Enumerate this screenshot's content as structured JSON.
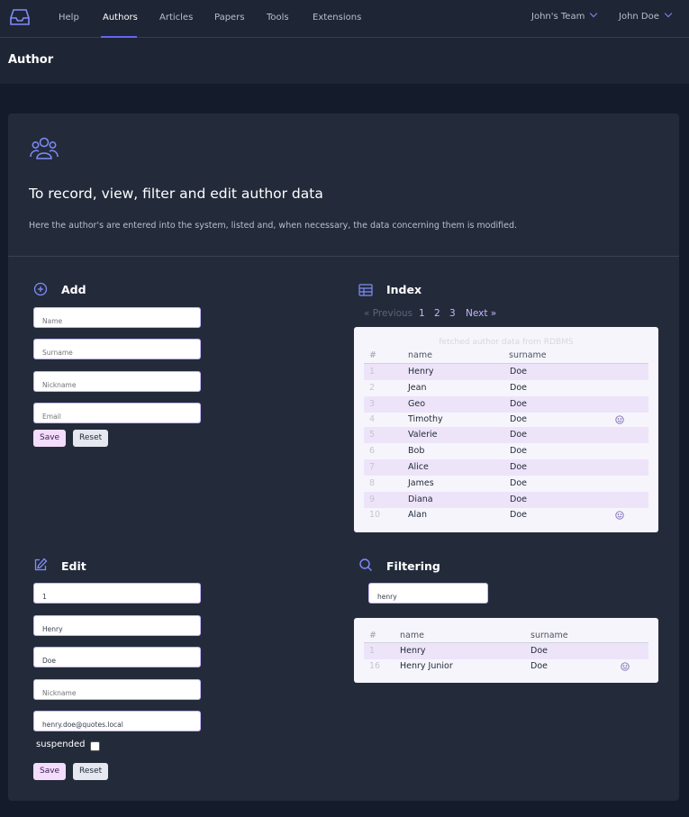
{
  "nav": {
    "logo": "inbox-logo-icon",
    "items": [
      {
        "label": "Help",
        "active": false
      },
      {
        "label": "Authors",
        "active": true
      },
      {
        "label": "Articles",
        "active": false
      },
      {
        "label": "Papers",
        "active": false
      },
      {
        "label": "Tools",
        "active": false
      },
      {
        "label": "Extensions",
        "active": false
      }
    ],
    "team_label": "John's Team",
    "user_label": "John Doe",
    "accent": "#6366f1"
  },
  "page": {
    "title": "Author"
  },
  "hero": {
    "icon": "user-group-icon",
    "title": "To record, view, filter and edit author data",
    "description": "Here the author's are entered into the system, listed and, when necessary, the data concerning them is modified."
  },
  "add": {
    "title": "Add",
    "icon": "plus-circle-icon",
    "name_placeholder": "Name",
    "surname_placeholder": "Surname",
    "nickname_placeholder": "Nickname",
    "email_placeholder": "Email",
    "save_label": "Save",
    "reset_label": "Reset"
  },
  "index": {
    "title": "Index",
    "icon": "table-icon",
    "pagination": {
      "previous": "« Previous",
      "pages": [
        "1",
        "2",
        "3"
      ],
      "next": "Next »"
    },
    "caption": "fetched author data from RDBMS",
    "columns": [
      "#",
      "name",
      "surname"
    ],
    "rows": [
      {
        "id": "1",
        "name": "Henry",
        "surname": "Doe",
        "smile": false
      },
      {
        "id": "2",
        "name": "Jean",
        "surname": "Doe",
        "smile": false
      },
      {
        "id": "3",
        "name": "Geo",
        "surname": "Doe",
        "smile": false
      },
      {
        "id": "4",
        "name": "Timothy",
        "surname": "Doe",
        "smile": true
      },
      {
        "id": "5",
        "name": "Valerie",
        "surname": "Doe",
        "smile": false
      },
      {
        "id": "6",
        "name": "Bob",
        "surname": "Doe",
        "smile": false
      },
      {
        "id": "7",
        "name": "Alice",
        "surname": "Doe",
        "smile": false
      },
      {
        "id": "8",
        "name": "James",
        "surname": "Doe",
        "smile": false
      },
      {
        "id": "9",
        "name": "Diana",
        "surname": "Doe",
        "smile": false
      },
      {
        "id": "10",
        "name": "Alan",
        "surname": "Doe",
        "smile": true
      }
    ]
  },
  "edit": {
    "title": "Edit",
    "icon": "pencil-square-icon",
    "id_value": "1",
    "name_value": "Henry",
    "surname_value": "Doe",
    "nickname_placeholder": "Nickname",
    "email_value": "henry.doe@quotes.local",
    "suspended_label": "suspended",
    "suspended_checked": false,
    "save_label": "Save",
    "reset_label": "Reset"
  },
  "filtering": {
    "title": "Filtering",
    "icon": "search-icon",
    "query": "henry",
    "columns": [
      "#",
      "name",
      "surname"
    ],
    "rows": [
      {
        "id": "1",
        "name": "Henry",
        "surname": "Doe",
        "smile": false
      },
      {
        "id": "16",
        "name": "Henry Junior",
        "surname": "Doe",
        "smile": true
      }
    ]
  }
}
